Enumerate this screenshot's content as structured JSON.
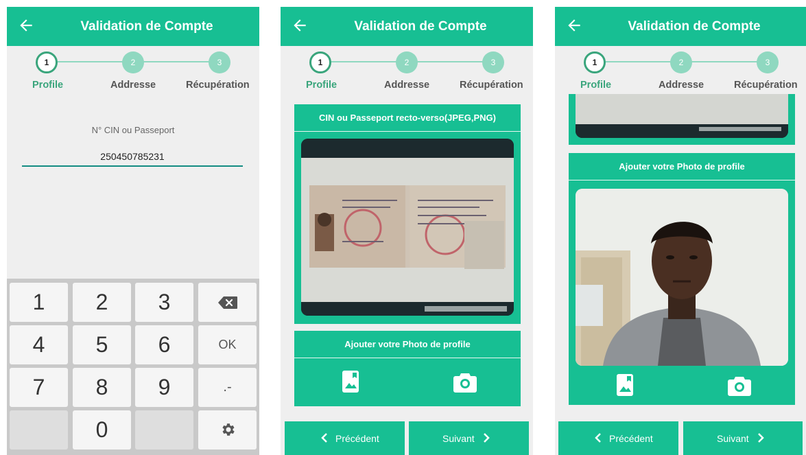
{
  "app": {
    "title": "Validation de Compte"
  },
  "steps": [
    {
      "number": "1",
      "label": "Profile"
    },
    {
      "number": "2",
      "label": "Addresse"
    },
    {
      "number": "3",
      "label": "Récupération"
    }
  ],
  "form": {
    "id_label": "N° CIN ou Passeport",
    "id_value": "250450785231"
  },
  "keypad": {
    "keys": [
      "1",
      "2",
      "3",
      "4",
      "5",
      "6",
      "OK",
      "7",
      "8",
      "9",
      ".-",
      "0"
    ]
  },
  "upload": {
    "id_card_title": "CIN ou Passeport recto-verso(JPEG,PNG)",
    "profile_photo_title": "Ajouter votre Photo de profile"
  },
  "navigation": {
    "previous": "Précédent",
    "next": "Suivant"
  },
  "colors": {
    "primary": "#17bf93",
    "step_active": "#3aa57c",
    "step_inactive": "#8fd8c0",
    "input_underline": "#138c82"
  },
  "icons": {
    "back": "arrow-left-icon",
    "gallery": "gallery-icon",
    "camera": "camera-icon",
    "backspace": "backspace-icon",
    "settings": "gear-icon"
  }
}
